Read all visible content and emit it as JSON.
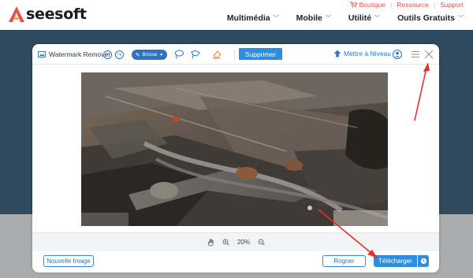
{
  "site": {
    "logo_text": "seesoft",
    "toplinks": {
      "shop": "Boutique",
      "resource": "Ressource",
      "support": "Support"
    },
    "nav": [
      {
        "label": "Multimédia"
      },
      {
        "label": "Mobile"
      },
      {
        "label": "Utilité"
      },
      {
        "label": "Outils Gratuits"
      }
    ],
    "colors": {
      "accent_red": "#e8504a",
      "header_bg": "#2f4a5e",
      "primary_blue": "#2f8ddf"
    }
  },
  "tool": {
    "title": "Watermark Remover",
    "brush_label": "Brosse",
    "remove_label": "Supprimer",
    "upgrade_label": "Mettre à Niveau",
    "zoom": "20%",
    "new_image_label": "Nouvelle Image",
    "crop_label": "Rogner",
    "download_label": "Télécharger",
    "icons": [
      "undo-icon",
      "redo-icon",
      "lasso-icon",
      "polygon-lasso-icon",
      "eraser-icon",
      "upgrade-icon",
      "account-icon",
      "menu-icon",
      "close-icon",
      "hand-icon",
      "zoom-in-icon",
      "zoom-out-icon",
      "clock-icon"
    ]
  }
}
